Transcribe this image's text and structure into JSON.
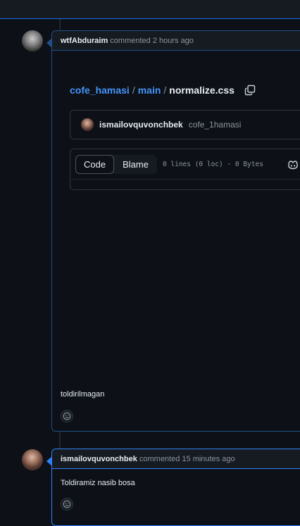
{
  "comments": [
    {
      "author": "wtfAbduraim",
      "action": "commented 2 hours ago",
      "embed": {
        "repo": "cofe_hamasi",
        "branch": "main",
        "file": "normalize.css",
        "commit_author": "ismailovquvonchbek",
        "commit_message": "cofe_1hamasi",
        "tabs": [
          "Code",
          "Blame"
        ],
        "file_meta": "0 lines (0 loc) · 0 Bytes"
      },
      "body": "toldirilmagan"
    },
    {
      "author": "ismailovquvonchbek",
      "action": "commented 15 minutes ago",
      "body": "Toldiramiz nasib bosa"
    }
  ]
}
